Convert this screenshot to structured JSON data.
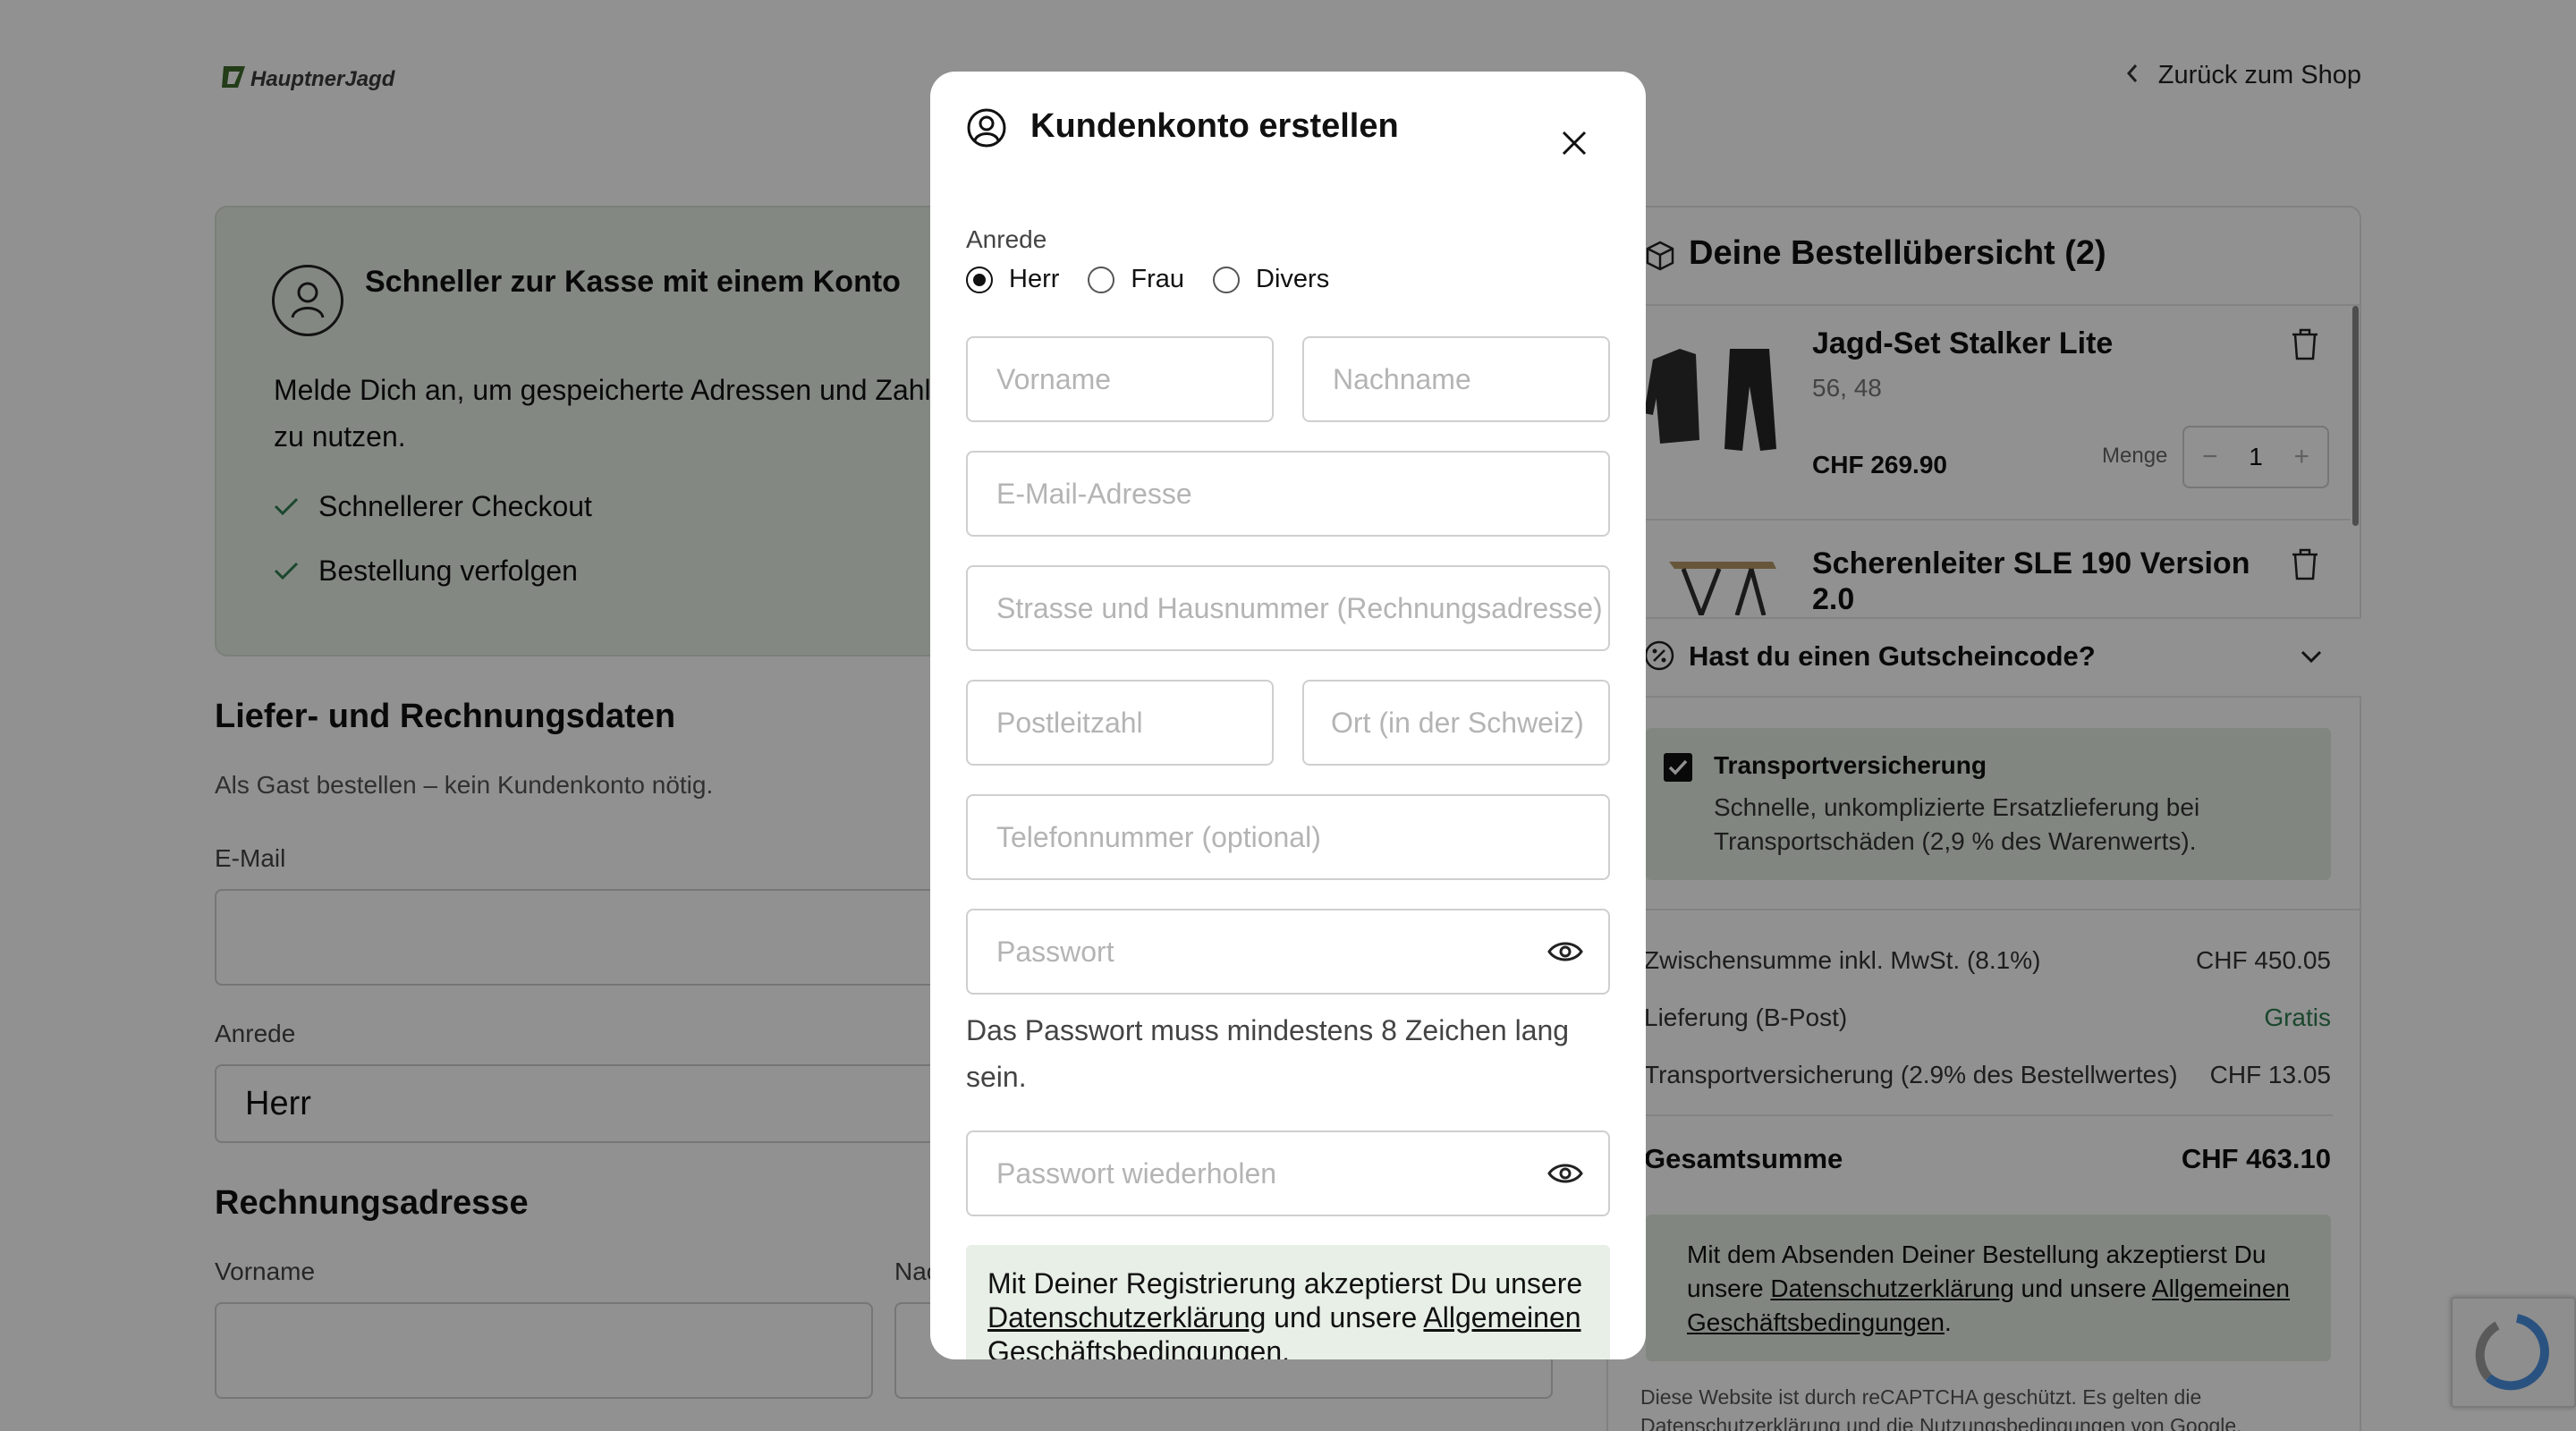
{
  "header": {
    "logo_text": "HauptnerJagd",
    "back_label": "Zurück zum Shop"
  },
  "promo": {
    "title": "Schneller zur Kasse mit einem Konto",
    "text": "Melde Dich an, um gespeicherte Adressen und Zahlu​ zu nutzen.",
    "text_line1": "Melde Dich an, um gespeicherte Adressen und Zahlu",
    "text_line2": "zu nutzen.",
    "benefits": [
      "Schnellerer Checkout",
      "Bestellung verfolgen"
    ]
  },
  "guest": {
    "title": "Liefer- und Rechnungsdaten",
    "subtitle": "Als Gast bestellen – kein Kundenkonto nötig.",
    "email_label": "E-Mail",
    "salutation_label": "Anrede",
    "salutation_value": "Herr",
    "billing_title": "Rechnungsadresse",
    "firstname_label": "Vorname",
    "lastname_label": "Nac"
  },
  "order": {
    "title": "Deine Bestellübersicht (2)",
    "items": [
      {
        "name": "Jagd-Set Stalker Lite",
        "variant": "56, 48",
        "price": "CHF 269.90",
        "qty_label": "Menge",
        "qty": "1",
        "minus": "−",
        "plus": "+"
      },
      {
        "name": "Scherenleiter SLE 190 Version 2.0"
      }
    ],
    "voucher_label": "Hast du einen Gutscheincode?",
    "insurance": {
      "checked": true,
      "title": "Transportversicherung",
      "text": "Schnelle, unkomplizierte Ersatzlieferung bei Transportschäden (2,9 % des Warenwerts)."
    },
    "summary": [
      {
        "label": "Zwischensumme inkl. MwSt. (8.1%)",
        "value": "CHF 450.05"
      },
      {
        "label": "Lieferung (B-Post)",
        "value": "Gratis"
      },
      {
        "label": "Transportversicherung (2.9% des Bestellwertes)",
        "value": "CHF 13.05"
      }
    ],
    "total_label": "Gesamtsumme",
    "total_value": "CHF 463.10",
    "legal_pre": "Mit dem Absenden Deiner Bestellung akzeptierst Du unsere ",
    "legal_link1": "Datenschutzerklärung",
    "legal_mid": " und unsere ",
    "legal_link2": "Allgemeinen Geschäftsbedingungen",
    "legal_post": ".",
    "recaptcha_note": "Diese Website ist durch reCAPTCHA geschützt. Es gelten die Datenschutzerklärung und die Nutzungsbedingungen von Google."
  },
  "modal": {
    "title": "Kundenkonto erstellen",
    "salutation_label": "Anrede",
    "salutation_options": [
      {
        "label": "Herr",
        "selected": true
      },
      {
        "label": "Frau",
        "selected": false
      },
      {
        "label": "Divers",
        "selected": false
      }
    ],
    "placeholders": {
      "firstname": "Vorname",
      "lastname": "Nachname",
      "email": "E-Mail-Adresse",
      "street": "Strasse und Hausnummer (Rechnungsadresse)",
      "zip": "Postleitzahl",
      "city": "Ort (in der Schweiz)",
      "phone": "Telefonnummer (optional)",
      "password": "Passwort",
      "password_repeat": "Passwort wiederholen"
    },
    "password_hint": "Das Passwort muss mindestens 8 Zeichen lang sein.",
    "legal_pre": "Mit Deiner Registrierung akzeptierst Du unsere ",
    "legal_link1": "Datenschutzerklärung",
    "legal_mid": " und unsere ",
    "legal_link2": "Allgemeinen Geschäftsbedingungen",
    "legal_post": "."
  },
  "colors": {
    "accent_green": "#2e7d4f",
    "promo_bg": "#e8efe7",
    "overlay": "rgba(0,0,0,0.43)"
  }
}
